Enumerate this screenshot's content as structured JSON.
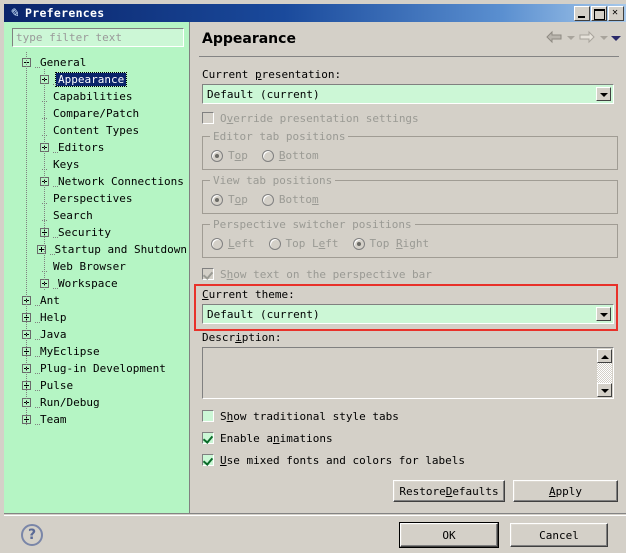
{
  "window": {
    "title": "Preferences",
    "icon": "preferences-icon",
    "buttons": {
      "minimize": "minimize-icon",
      "maximize": "maximize-icon",
      "close": "close-icon"
    }
  },
  "sidebar": {
    "filter_placeholder": "type filter text",
    "filter_value": "",
    "tree": [
      {
        "label": "General",
        "depth": 0,
        "toggle": "minus",
        "selected": false
      },
      {
        "label": "Appearance",
        "depth": 1,
        "toggle": "plus",
        "selected": true
      },
      {
        "label": "Capabilities",
        "depth": 1,
        "toggle": "leaf",
        "selected": false
      },
      {
        "label": "Compare/Patch",
        "depth": 1,
        "toggle": "leaf",
        "selected": false
      },
      {
        "label": "Content Types",
        "depth": 1,
        "toggle": "leaf",
        "selected": false
      },
      {
        "label": "Editors",
        "depth": 1,
        "toggle": "plus",
        "selected": false
      },
      {
        "label": "Keys",
        "depth": 1,
        "toggle": "leaf",
        "selected": false
      },
      {
        "label": "Network Connections",
        "depth": 1,
        "toggle": "plus",
        "selected": false
      },
      {
        "label": "Perspectives",
        "depth": 1,
        "toggle": "leaf",
        "selected": false
      },
      {
        "label": "Search",
        "depth": 1,
        "toggle": "leaf",
        "selected": false
      },
      {
        "label": "Security",
        "depth": 1,
        "toggle": "plus",
        "selected": false
      },
      {
        "label": "Startup and Shutdown",
        "depth": 1,
        "toggle": "plus",
        "selected": false
      },
      {
        "label": "Web Browser",
        "depth": 1,
        "toggle": "leaf",
        "selected": false
      },
      {
        "label": "Workspace",
        "depth": 1,
        "toggle": "plus",
        "selected": false
      },
      {
        "label": "Ant",
        "depth": 0,
        "toggle": "plus",
        "selected": false
      },
      {
        "label": "Help",
        "depth": 0,
        "toggle": "plus",
        "selected": false
      },
      {
        "label": "Java",
        "depth": 0,
        "toggle": "plus",
        "selected": false
      },
      {
        "label": "MyEclipse",
        "depth": 0,
        "toggle": "plus",
        "selected": false
      },
      {
        "label": "Plug-in Development",
        "depth": 0,
        "toggle": "plus",
        "selected": false
      },
      {
        "label": "Pulse",
        "depth": 0,
        "toggle": "plus",
        "selected": false
      },
      {
        "label": "Run/Debug",
        "depth": 0,
        "toggle": "plus",
        "selected": false
      },
      {
        "label": "Team",
        "depth": 0,
        "toggle": "plus",
        "selected": false
      }
    ]
  },
  "page": {
    "title": "Appearance",
    "nav": {
      "back": "back-arrow-icon",
      "back_menu": "chevron-down-icon",
      "forward": "forward-arrow-icon",
      "forward_menu": "chevron-down-icon",
      "view_menu": "view-menu-icon"
    },
    "presentation": {
      "label_pre": "Current ",
      "label_mn": "p",
      "label_post": "resentation:",
      "value": "Default (current)"
    },
    "override": {
      "label_pre": "O",
      "label_mn": "v",
      "label_post": "erride presentation settings",
      "checked": false,
      "enabled": false
    },
    "editor_tabs": {
      "title": "Editor tab positions",
      "options": [
        {
          "pre": "T",
          "mn": "o",
          "post": "p",
          "selected": true
        },
        {
          "pre": "",
          "mn": "B",
          "post": "ottom",
          "selected": false
        }
      ]
    },
    "view_tabs": {
      "title": "View tab positions",
      "options": [
        {
          "pre": "T",
          "mn": "o",
          "post": "p",
          "selected": true
        },
        {
          "pre": "Botto",
          "mn": "m",
          "post": "",
          "selected": false
        }
      ]
    },
    "perspective_switcher": {
      "title": "Perspective switcher positions",
      "options": [
        {
          "pre": "",
          "mn": "L",
          "post": "eft",
          "selected": false
        },
        {
          "pre": "Top L",
          "mn": "e",
          "post": "ft",
          "selected": false
        },
        {
          "pre": "Top ",
          "mn": "R",
          "post": "ight",
          "selected": true
        }
      ]
    },
    "show_perspective_text": {
      "label_pre": "S",
      "label_mn": "h",
      "label_post": "ow text on the perspective bar",
      "checked": true,
      "enabled": false
    },
    "theme": {
      "label_pre": "",
      "label_mn": "C",
      "label_post": "urrent theme:",
      "value": "Default (current)",
      "highlight_color": "#e8312a"
    },
    "description": {
      "label_pre": "Descr",
      "label_mn": "i",
      "label_post": "ption:",
      "value": ""
    },
    "traditional_tabs": {
      "label_pre": "S",
      "label_mn": "h",
      "label_post": "ow traditional style tabs",
      "checked": false,
      "enabled": true
    },
    "enable_animations": {
      "label_pre": "Enable a",
      "label_mn": "n",
      "label_post": "imations",
      "checked": true,
      "enabled": true
    },
    "mixed_fonts": {
      "label_pre": "",
      "label_mn": "U",
      "label_post": "se mixed fonts and colors for labels",
      "checked": true,
      "enabled": true
    },
    "restore_defaults": {
      "pre": "Restore ",
      "mn": "D",
      "post": "efaults"
    },
    "apply": {
      "pre": "",
      "mn": "A",
      "post": "pply"
    }
  },
  "footer": {
    "help_icon": "help-icon",
    "ok": "OK",
    "cancel": "Cancel"
  }
}
